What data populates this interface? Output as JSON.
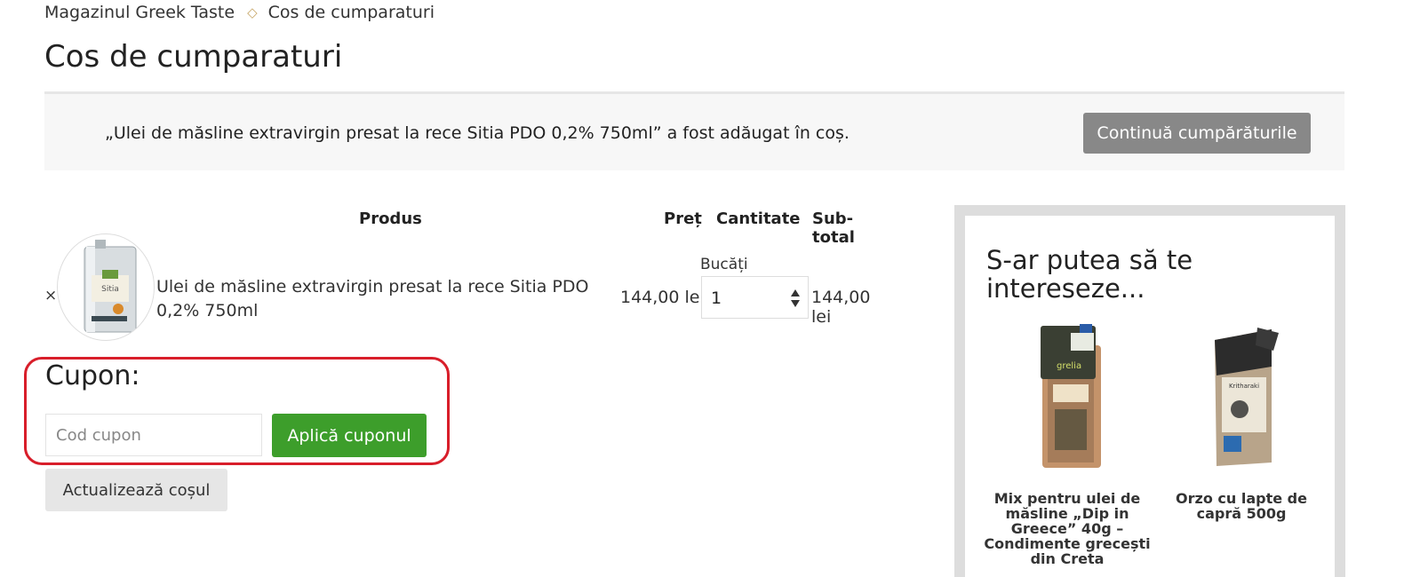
{
  "breadcrumb": {
    "home": "Magazinul Greek Taste",
    "current": "Cos de cumparaturi"
  },
  "page_title": "Cos de cumparaturi",
  "notice": {
    "message": "„Ulei de măsline extravirgin presat la rece Sitia PDO 0,2% 750ml” a fost adăugat în coș.",
    "button": "Continuă cumpărăturile"
  },
  "cart": {
    "headers": {
      "product": "Produs",
      "price": "Preț",
      "quantity": "Cantitate",
      "subtotal": "Sub-total"
    },
    "items": [
      {
        "remove": "×",
        "name": "Ulei de măsline extravirgin presat la rece Sitia PDO 0,2% 750ml",
        "price": "144,00 lei",
        "quantity_label": "Bucăți",
        "quantity": "1",
        "subtotal": "144,00 lei",
        "image_text": "Sitia"
      }
    ]
  },
  "coupon": {
    "title": "Cupon:",
    "placeholder": "Cod cupon",
    "apply_button": "Aplică cuponul"
  },
  "update_button": "Actualizează coșul",
  "sidebar": {
    "title": "S-ar putea să te intereseze...",
    "products": [
      {
        "name": "Mix pentru ulei de măsline „Dip in Greece” 40g – Condimente grecești din Creta",
        "image_text": "grelia"
      },
      {
        "name": "Orzo cu lapte de capră 500g",
        "image_text": "Kritharaki"
      }
    ]
  },
  "colors": {
    "continue_button": "#888888",
    "apply_button": "#3d9e2b",
    "highlight_border": "#d81e2a",
    "breadcrumb_separator": "#c8a86a"
  }
}
